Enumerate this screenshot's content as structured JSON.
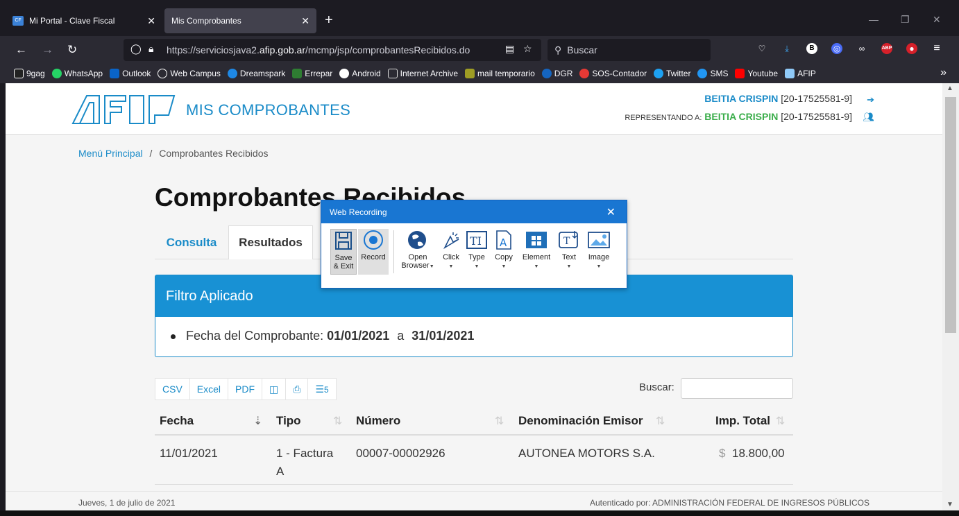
{
  "browser": {
    "tabs": [
      {
        "label": "Mi Portal - Clave Fiscal",
        "favicon": "CF"
      },
      {
        "label": "Mis Comprobantes"
      }
    ],
    "url_prefix": "https://serviciosjava2.",
    "url_domain": "afip.gob.ar",
    "url_path": "/mcmp/jsp/comprobantesRecibidos.do",
    "search_placeholder": "Buscar",
    "bookmarks": [
      {
        "label": "9gag",
        "color": "#222222"
      },
      {
        "label": "WhatsApp",
        "color": "#25d366"
      },
      {
        "label": "Outlook",
        "color": "#0a64c8"
      },
      {
        "label": "Web Campus",
        "color": "#555555"
      },
      {
        "label": "Dreamspark",
        "color": "#1e88e5"
      },
      {
        "label": "Errepar",
        "color": "#2e7d32"
      },
      {
        "label": "Android",
        "color": "#ffffff"
      },
      {
        "label": "Internet Archive",
        "color": "#dddddd"
      },
      {
        "label": "mail temporario",
        "color": "#9e9d24"
      },
      {
        "label": "DGR",
        "color": "#1565c0"
      },
      {
        "label": "SOS-Contador",
        "color": "#e53935"
      },
      {
        "label": "Twitter",
        "color": "#1da1f2"
      },
      {
        "label": "SMS",
        "color": "#2196f3"
      },
      {
        "label": "Youtube",
        "color": "#ff0000"
      },
      {
        "label": "AFIP",
        "color": "#90caf9"
      }
    ]
  },
  "header": {
    "logo_text": "AFIP",
    "app_title": "MIS COMPROBANTES",
    "user_name": "BEITIA CRISPIN",
    "user_cuit": "[20-17525581-9]",
    "rep_label": "REPRESENTANDO A:",
    "rep_name": "BEITIA CRISPIN",
    "rep_cuit": "[20-17525581-9]"
  },
  "breadcrumb": {
    "home": "Menú Principal",
    "separator": "/",
    "current": "Comprobantes Recibidos"
  },
  "page_title": "Comprobantes Recibidos",
  "tabs": {
    "consulta": "Consulta",
    "resultados": "Resultados"
  },
  "filter": {
    "title": "Filtro Aplicado",
    "label": "Fecha del Comprobante:",
    "from": "01/01/2021",
    "connector": "a",
    "to": "31/01/2021"
  },
  "export": {
    "csv": "CSV",
    "excel": "Excel",
    "pdf": "PDF",
    "columns_count": "5"
  },
  "search_label": "Buscar:",
  "table": {
    "columns": [
      "Fecha",
      "Tipo",
      "Número",
      "Denominación Emisor",
      "Imp. Total"
    ],
    "rows": [
      {
        "fecha": "11/01/2021",
        "tipo_1": "1 - Factura",
        "tipo_2": "A",
        "numero": "00007-00002926",
        "emisor": "AUTONEA MOTORS S.A.",
        "currency": "$",
        "total": "18.800,00"
      }
    ]
  },
  "footer": {
    "date": "Jueves, 1 de julio de 2021",
    "auth": "Autenticado por: ADMINISTRACIÓN FEDERAL DE INGRESOS PÚBLICOS"
  },
  "web_recording": {
    "title": "Web Recording",
    "tools": {
      "save": "Save",
      "save2": "& Exit",
      "record": "Record",
      "open": "Open",
      "open2": "Browser",
      "click": "Click",
      "type": "Type",
      "copy": "Copy",
      "element": "Element",
      "text": "Text",
      "image": "Image"
    }
  },
  "colors": {
    "accent": "#1a8bc8",
    "filter_header": "#1891d4",
    "rep_green": "#3aad4a",
    "recorder_title": "#1976d2"
  }
}
